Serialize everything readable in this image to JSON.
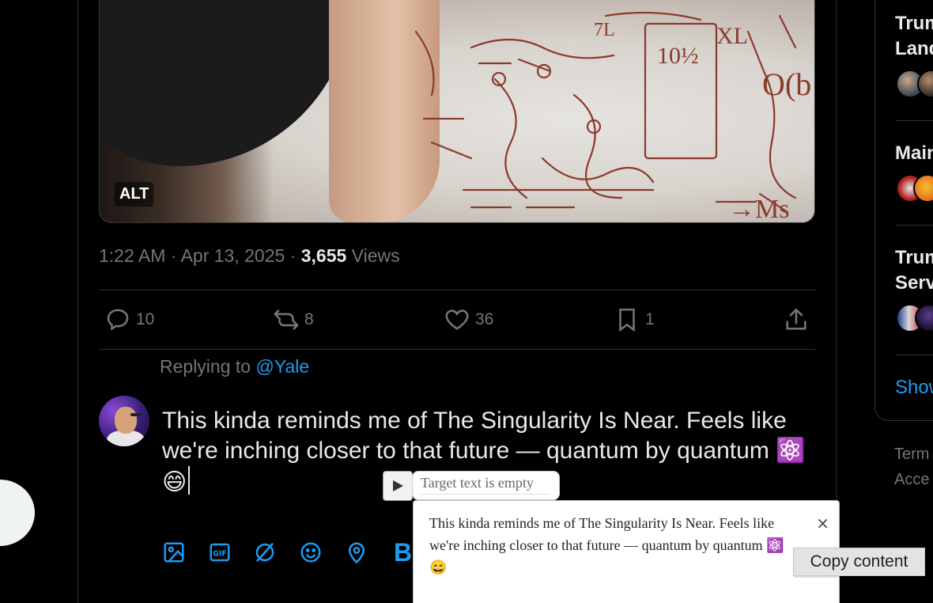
{
  "media": {
    "alt_badge": "ALT",
    "board_scribbles": [
      "10½",
      "XL",
      "O(b",
      "→Ms",
      "7L"
    ]
  },
  "tweet_meta": {
    "time": "1:22 AM",
    "sep1": " · ",
    "date": "Apr 13, 2025",
    "sep2": " · ",
    "views_count": "3,655",
    "views_label": " Views"
  },
  "actions": {
    "reply_count": "10",
    "retweet_count": "8",
    "like_count": "36",
    "bookmark_count": "1"
  },
  "reply": {
    "replying_prefix": "Replying to ",
    "replying_handle": "@Yale",
    "draft_text": "This kinda reminds me of The Singularity Is Near. Feels like we're inching closer to that future — quantum by quantum ⚛️ 😄"
  },
  "extension": {
    "target_text": "Target text is empty",
    "popup_text": "This kinda reminds me of The Singularity Is Near. Feels like we're inching closer to that future — quantum by quantum ⚛️ 😄",
    "close_glyph": "×",
    "copy_tooltip": "Copy content"
  },
  "sidebar": {
    "trends": [
      {
        "title_line1": "Trum",
        "title_line2": "Land"
      },
      {
        "title_line1": "Main",
        "title_line2": ""
      },
      {
        "title_line1": "Trum",
        "title_line2": "Serv"
      }
    ],
    "show_more": "Show",
    "footer_links": [
      "Term",
      "Acce"
    ]
  },
  "colors": {
    "accent": "#1d9bf0",
    "background": "#000000",
    "muted_text": "#71767b",
    "border": "#2f3336"
  }
}
